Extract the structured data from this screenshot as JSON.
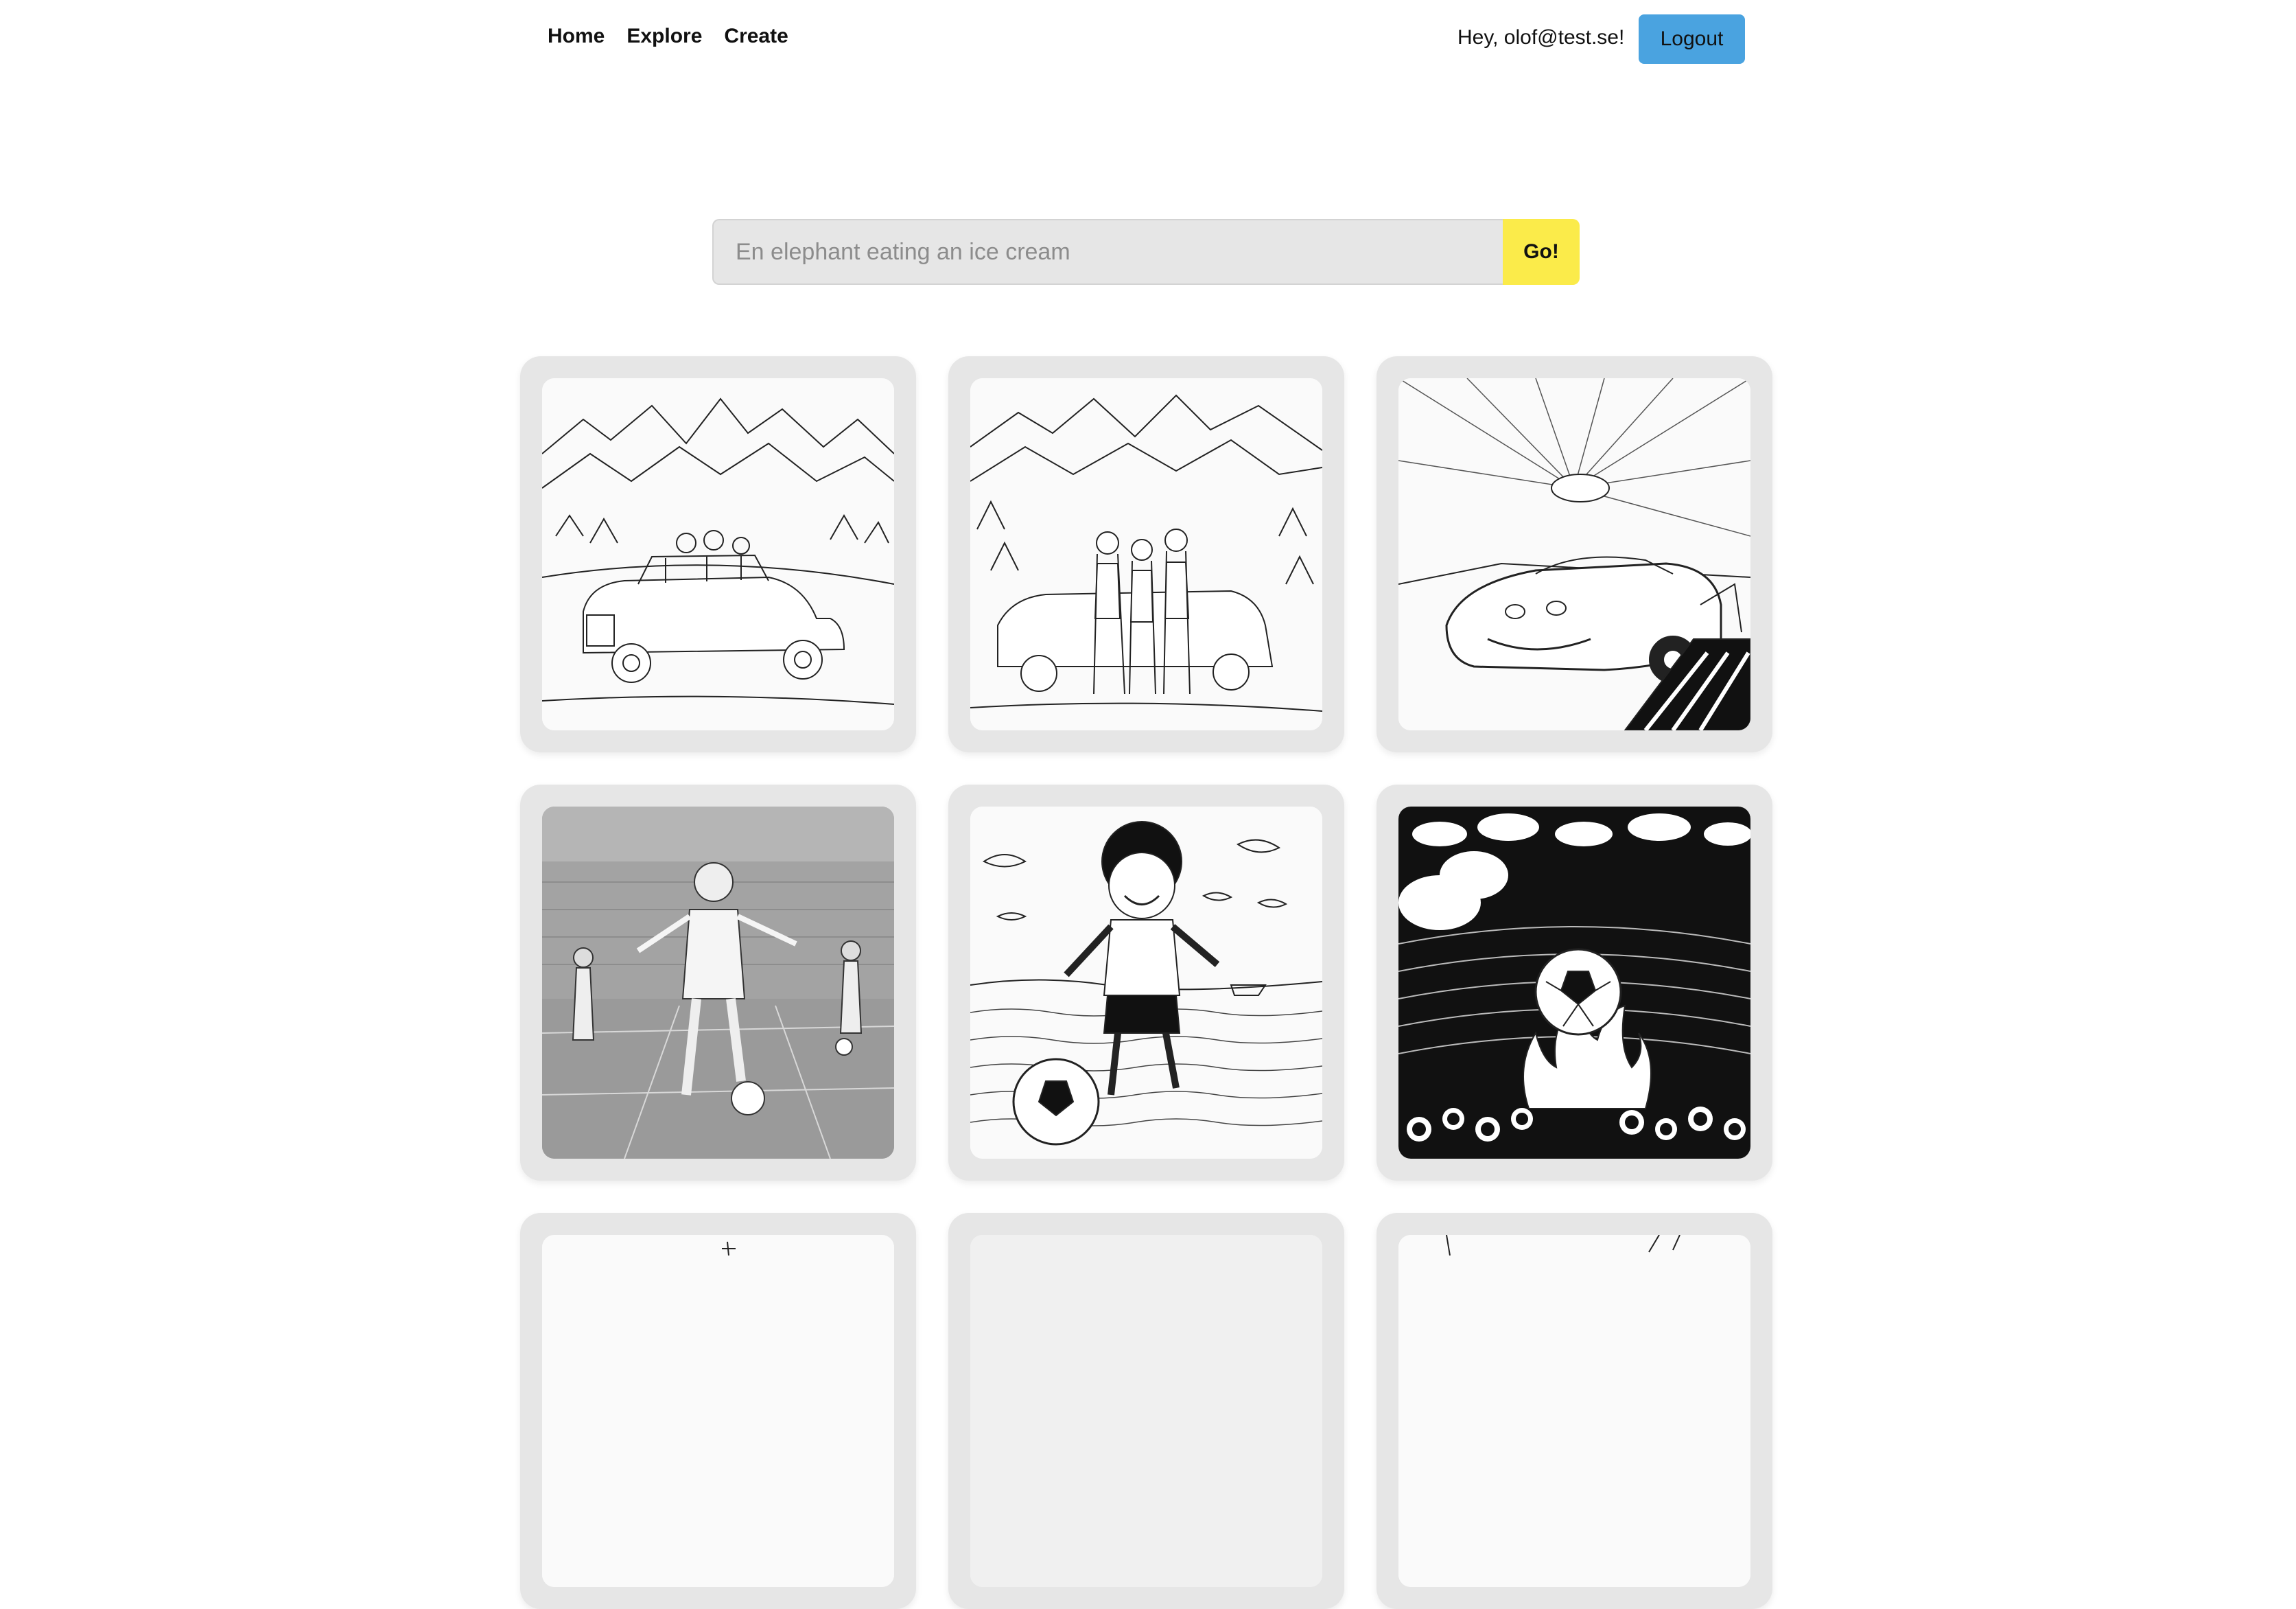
{
  "nav": {
    "links": [
      {
        "label": "Home"
      },
      {
        "label": "Explore"
      },
      {
        "label": "Create"
      }
    ],
    "greeting": "Hey, olof@test.se!",
    "logout_label": "Logout"
  },
  "search": {
    "placeholder": "En elephant eating an ice cream",
    "value": "",
    "go_label": "Go!"
  },
  "gallery": {
    "images": [
      {
        "icon": "coloring-car-mountains-image"
      },
      {
        "icon": "coloring-friends-car-mountains-image"
      },
      {
        "icon": "coloring-race-car-image"
      },
      {
        "icon": "coloring-soccer-stadium-image"
      },
      {
        "icon": "coloring-boy-soccer-sea-image"
      },
      {
        "icon": "coloring-flaming-soccer-ball-image"
      },
      {
        "icon": "coloring-page-image"
      },
      {
        "icon": "coloring-page-image"
      },
      {
        "icon": "coloring-page-image"
      }
    ]
  },
  "colors": {
    "logout_button": "#4aa3e0",
    "go_button": "#fbeb4a",
    "card_background": "#e6e6e6"
  }
}
